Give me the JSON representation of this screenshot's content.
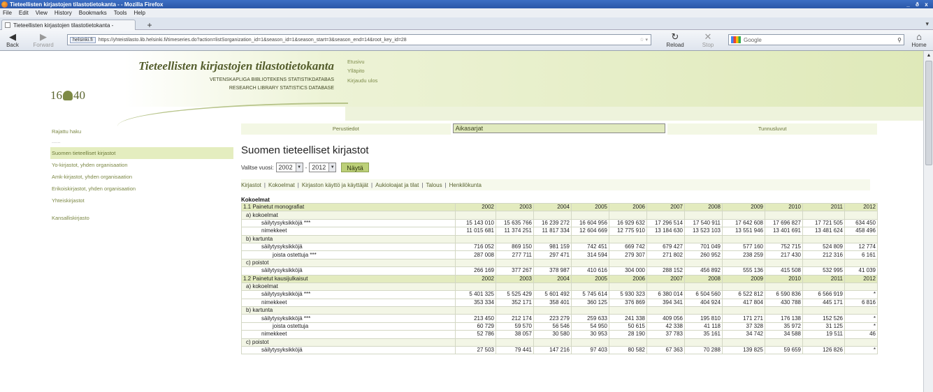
{
  "browser": {
    "window_title": "Tieteellisten kirjastojen tilastotietokanta - - Mozilla Firefox",
    "window_controls": [
      "_",
      "ð",
      "x"
    ],
    "menu": [
      "File",
      "Edit",
      "View",
      "History",
      "Bookmarks",
      "Tools",
      "Help"
    ],
    "tab_title": "Tieteellisten kirjastojen tilastotietokanta -",
    "new_tab": "+",
    "back_label": "Back",
    "forward_label": "Forward",
    "reload_label": "Reload",
    "stop_label": "Stop",
    "home_label": "Home",
    "site_identity": "helsinki.fi",
    "url": "https://yhteistilasto.lib.helsinki.fi/timeseries.do?action=listSorganization_id=1&season_id=1&season_start=3&season_end=14&root_key_id=28",
    "search_placeholder": "Google"
  },
  "site": {
    "title": "Tieteellisten kirjastojen tilastotietokanta",
    "subtitle_sv": "VETENSKAPLIGA BIBLIOTEKENS STATISTIKDATABAS",
    "subtitle_en": "RESEARCH LIBRARY STATISTICS DATABASE",
    "logo_left": "16",
    "logo_right": "40",
    "top_links": [
      "Etusivu",
      "Ylläpito",
      "Kirjaudu ulos"
    ]
  },
  "sidebar": {
    "items": [
      {
        "label": "Rajattu haku",
        "kind": "link"
      },
      {
        "label": "......",
        "kind": "dots"
      },
      {
        "label": "Suomen tieteelliset kirjastot",
        "kind": "active"
      },
      {
        "label": "Yo-kirjastot, yhden organisaation",
        "kind": "link"
      },
      {
        "label": "Amk-kirjastot, yhden organisaation",
        "kind": "link"
      },
      {
        "label": "Erikoiskirjastot, yhden organisaation",
        "kind": "link"
      },
      {
        "label": "Yhteiskirjastot",
        "kind": "link"
      },
      {
        "label": "Kansalliskirjasto",
        "kind": "link"
      }
    ]
  },
  "main": {
    "tabs": [
      "Perustiedot",
      "Aikasarjat",
      "Tunnusluvut"
    ],
    "selected_tab": 1,
    "heading": "Suomen tieteelliset kirjastot",
    "year_prompt": "Valitse vuosi:",
    "year_start": "2002",
    "year_end": "2012",
    "year_dash": "-",
    "show_button": "Näytä",
    "subnav": [
      "Kirjastot",
      "Kokoelmat",
      "Kirjaston käyttö ja käyttäjät",
      "Aukioloajat ja tilat",
      "Talous",
      "Henkilökunta"
    ],
    "subnav_sep": "|",
    "section_label": "Kokoelmat"
  },
  "table": {
    "rows": [
      {
        "type": "head",
        "label": "1.1 Painetut monografiat",
        "values": [
          "2002",
          "2003",
          "2004",
          "2005",
          "2006",
          "2007",
          "2008",
          "2009",
          "2010",
          "2011",
          "2012"
        ]
      },
      {
        "type": "sub",
        "level": 1,
        "label": "a) kokoelmat",
        "values": []
      },
      {
        "type": "row",
        "level": 2,
        "label": "säilytysyksikköjä ***",
        "values": [
          "15 143 010",
          "15 635 766",
          "16 239 272",
          "16 604 956",
          "16 929 632",
          "17 296 514",
          "17 540 911",
          "17 642 608",
          "17 696 827",
          "17 721 505",
          "634 450"
        ]
      },
      {
        "type": "row",
        "level": 2,
        "label": "nimekkeet",
        "values": [
          "11 015 681",
          "11 374 251",
          "11 817 334",
          "12 604 669",
          "12 775 910",
          "13 184 630",
          "13 523 103",
          "13 551 946",
          "13 401 691",
          "13 481 624",
          "458 496"
        ]
      },
      {
        "type": "sub",
        "level": 1,
        "label": "b) kartunta",
        "values": []
      },
      {
        "type": "row",
        "level": 2,
        "label": "säilytysyksikköjä",
        "values": [
          "716 052",
          "869 150",
          "981 159",
          "742 451",
          "669 742",
          "679 427",
          "701 049",
          "577 160",
          "752 715",
          "524 809",
          "12 774"
        ]
      },
      {
        "type": "row",
        "level": 3,
        "label": "joista ostettuja ***",
        "values": [
          "287 008",
          "277 711",
          "297 471",
          "314 594",
          "279 307",
          "271 802",
          "260 952",
          "238 259",
          "217 430",
          "212 316",
          "6 161"
        ]
      },
      {
        "type": "sub",
        "level": 1,
        "label": "c) poistot",
        "values": []
      },
      {
        "type": "row",
        "level": 2,
        "label": "säilytysyksikköjä",
        "values": [
          "266 169",
          "377 267",
          "378 987",
          "410 616",
          "304 000",
          "288 152",
          "456 892",
          "555 136",
          "415 508",
          "532 995",
          "41 039"
        ]
      },
      {
        "type": "head",
        "label": "1.2 Painetut kausijulkaisut",
        "values": [
          "2002",
          "2003",
          "2004",
          "2005",
          "2006",
          "2007",
          "2008",
          "2009",
          "2010",
          "2011",
          "2012"
        ]
      },
      {
        "type": "sub",
        "level": 1,
        "label": "a) kokoelmat",
        "values": []
      },
      {
        "type": "row",
        "level": 2,
        "label": "säilytysyksikköjä ***",
        "values": [
          "5 401 325",
          "5 525 429",
          "5 601 492",
          "5 745 614",
          "5 930 323",
          "6 380 014",
          "6 504 560",
          "6 522 812",
          "6 590 836",
          "6 566 919",
          "*"
        ]
      },
      {
        "type": "row",
        "level": 2,
        "label": "nimekkeet",
        "values": [
          "353 334",
          "352 171",
          "358 401",
          "360 125",
          "376 869",
          "394 341",
          "404 924",
          "417 804",
          "430 788",
          "445 171",
          "6 816"
        ]
      },
      {
        "type": "sub",
        "level": 1,
        "label": "b) kartunta",
        "values": []
      },
      {
        "type": "row",
        "level": 2,
        "label": "säilytysyksikköjä ***",
        "values": [
          "213 450",
          "212 174",
          "223 279",
          "259 633",
          "241 338",
          "409 056",
          "195 810",
          "171 271",
          "176 138",
          "152 526",
          "*"
        ]
      },
      {
        "type": "row",
        "level": 3,
        "label": "joista ostettuja",
        "values": [
          "60 729",
          "59 570",
          "56 546",
          "54 950",
          "50 615",
          "42 338",
          "41 118",
          "37 328",
          "35 972",
          "31 125",
          "*"
        ]
      },
      {
        "type": "row",
        "level": 2,
        "label": "nimekkeet",
        "values": [
          "52 786",
          "38 057",
          "30 580",
          "30 953",
          "28 190",
          "37 783",
          "35 161",
          "34 742",
          "34 588",
          "19 511",
          "46"
        ]
      },
      {
        "type": "sub",
        "level": 1,
        "label": "c) poistot",
        "values": []
      },
      {
        "type": "row",
        "level": 2,
        "label": "säilytysyksikköjä",
        "values": [
          "27 503",
          "79 441",
          "147 216",
          "97 403",
          "80 582",
          "67 363",
          "70 288",
          "139 825",
          "59 659",
          "126 826",
          "*"
        ]
      }
    ]
  },
  "colors": {
    "banner_green": "#dfe9b9",
    "header_row": "#e3ebbf",
    "link_green": "#7b8744",
    "button_green": "#bcd078"
  }
}
